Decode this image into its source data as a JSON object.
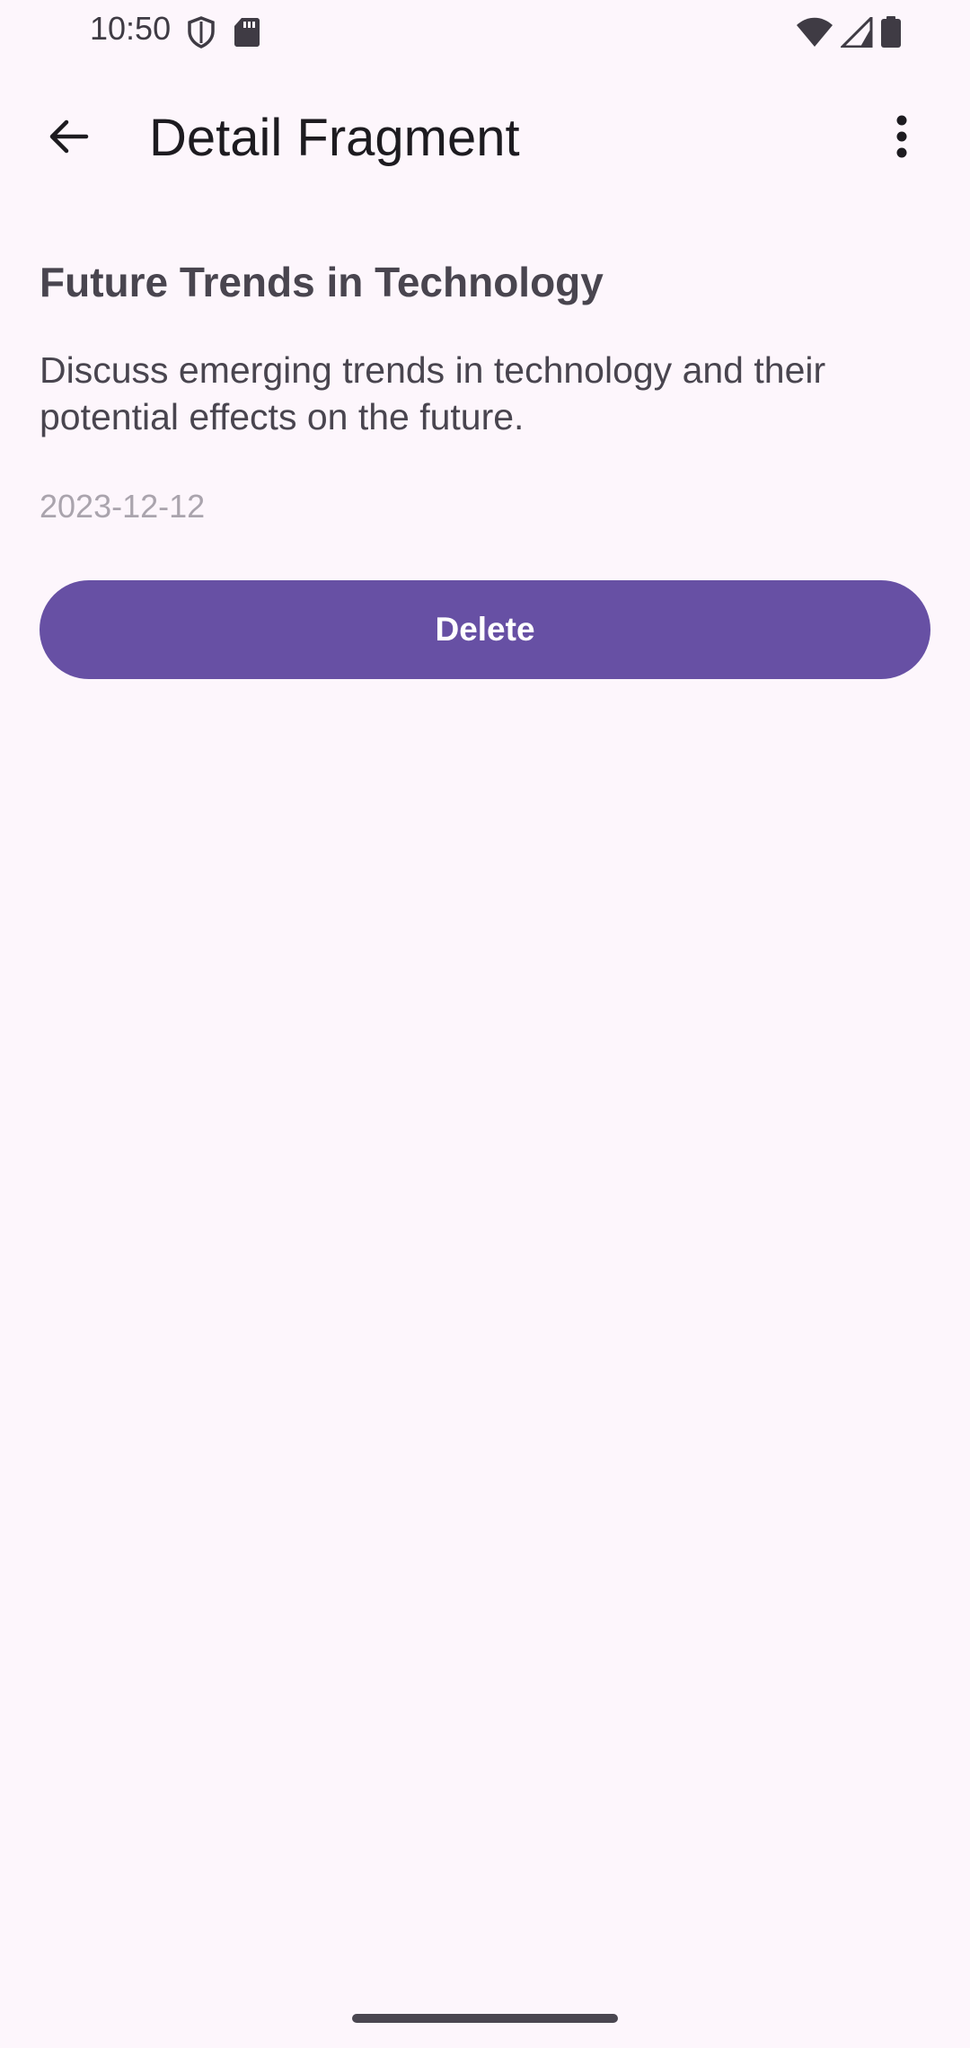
{
  "status_bar": {
    "time": "10:50",
    "left_icons": [
      "shield-icon",
      "sd-card-icon"
    ],
    "right_icons": [
      "wifi-icon",
      "signal-icon",
      "battery-icon"
    ]
  },
  "app_bar": {
    "title": "Detail Fragment",
    "back_icon": "arrow-back-icon",
    "more_icon": "more-vert-icon"
  },
  "detail": {
    "title": "Future Trends in Technology",
    "description": "Discuss emerging trends in technology and their potential effects on the future.",
    "date": "2023-12-12"
  },
  "actions": {
    "delete_label": "Delete"
  },
  "colors": {
    "background": "#fdf6fc",
    "primary": "#6750a4",
    "on_primary": "#ffffff",
    "text_secondary": "#49454f",
    "text_muted": "#aaa4ad"
  }
}
